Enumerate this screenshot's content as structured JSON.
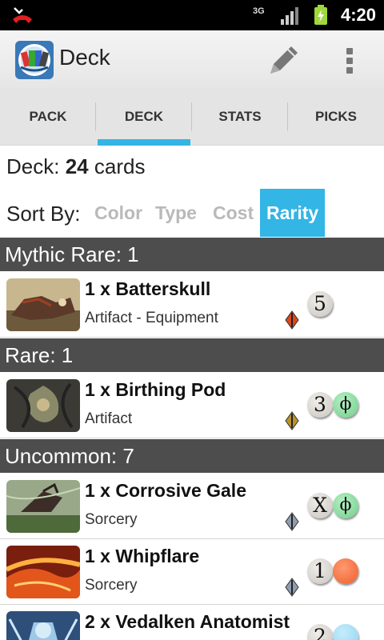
{
  "status_bar": {
    "time": "4:20",
    "network": "3G",
    "icons": [
      "missed-call-icon",
      "signal-icon",
      "battery-charging-icon"
    ]
  },
  "action_bar": {
    "title": "Deck",
    "icons": [
      "app-icon",
      "pencil-icon",
      "overflow-menu-icon"
    ]
  },
  "tabs": [
    {
      "label": "PACK",
      "active": false
    },
    {
      "label": "DECK",
      "active": true
    },
    {
      "label": "STATS",
      "active": false
    },
    {
      "label": "PICKS",
      "active": false
    }
  ],
  "summary": {
    "prefix": "Deck:",
    "count": "24",
    "suffix": "cards"
  },
  "sort": {
    "label": "Sort By:",
    "options": [
      "Color",
      "Type",
      "Cost",
      "Rarity"
    ],
    "selected": "Rarity"
  },
  "sections": [
    {
      "header": "Mythic Rare: 1",
      "cards": [
        {
          "name": "1 x Batterskull",
          "type": "Artifact  - Equipment",
          "set_rarity_color": "#d9481b",
          "cost": [
            {
              "symbol": "5",
              "kind": "colorless"
            }
          ]
        }
      ]
    },
    {
      "header": "Rare: 1",
      "cards": [
        {
          "name": "1 x Birthing Pod",
          "type": "Artifact",
          "set_rarity_color": "#b8922e",
          "cost": [
            {
              "symbol": "3",
              "kind": "colorless"
            },
            {
              "symbol": "ϕ",
              "kind": "phyrexian"
            }
          ]
        }
      ]
    },
    {
      "header": "Uncommon: 7",
      "cards": [
        {
          "name": "1 x Corrosive Gale",
          "type": "Sorcery",
          "set_rarity_color": "#8f9db0",
          "cost": [
            {
              "symbol": "X",
              "kind": "colorless"
            },
            {
              "symbol": "ϕ",
              "kind": "phyrexian"
            }
          ]
        },
        {
          "name": "1 x Whipflare",
          "type": "Sorcery",
          "set_rarity_color": "#8f9db0",
          "cost": [
            {
              "symbol": "1",
              "kind": "colorless"
            },
            {
              "symbol": "",
              "kind": "red"
            }
          ]
        },
        {
          "name": "2 x Vedalken Anatomist",
          "type": "",
          "set_rarity_color": "#8f9db0",
          "cost": [
            {
              "symbol": "2",
              "kind": "colorless"
            },
            {
              "symbol": "",
              "kind": "blue"
            }
          ]
        }
      ]
    }
  ],
  "colors": {
    "accent": "#33b5e5",
    "section_header": "#4d4d4d",
    "status_bar": "#000000"
  }
}
